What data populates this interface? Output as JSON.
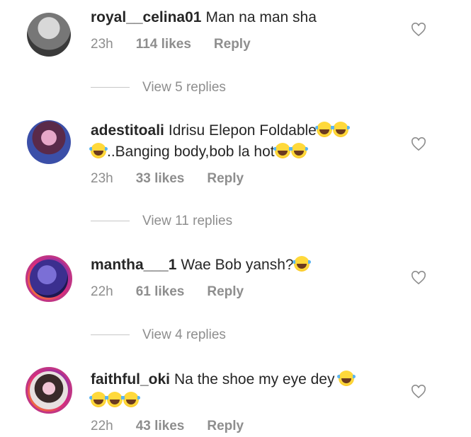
{
  "comments": [
    {
      "username": "royal__celina01",
      "text": "Man na man sha",
      "emoji_suffix": 0,
      "time": "23h",
      "likes": "114 likes",
      "reply": "Reply",
      "view_replies": "View 5 replies"
    },
    {
      "username": "adestitoali",
      "text_a": "Idrisu Elepon Foldable",
      "text_b": "..Banging body,bob la hot",
      "time": "23h",
      "likes": "33 likes",
      "reply": "Reply",
      "view_replies": "View 11 replies"
    },
    {
      "username": "mantha___1",
      "text": "Wae Bob yansh?",
      "time": "22h",
      "likes": "61 likes",
      "reply": "Reply",
      "view_replies": "View 4 replies"
    },
    {
      "username": "faithful_oki",
      "text": "Na the shoe my eye dey",
      "time": "22h",
      "likes": "43 likes",
      "reply": "Reply"
    }
  ],
  "icons": {
    "heart": "heart-outline-icon",
    "emoji": "face-with-tears-of-joy-emoji"
  },
  "colors": {
    "text": "#262626",
    "meta": "#8e8e8e",
    "story_ring": "#c13584"
  }
}
